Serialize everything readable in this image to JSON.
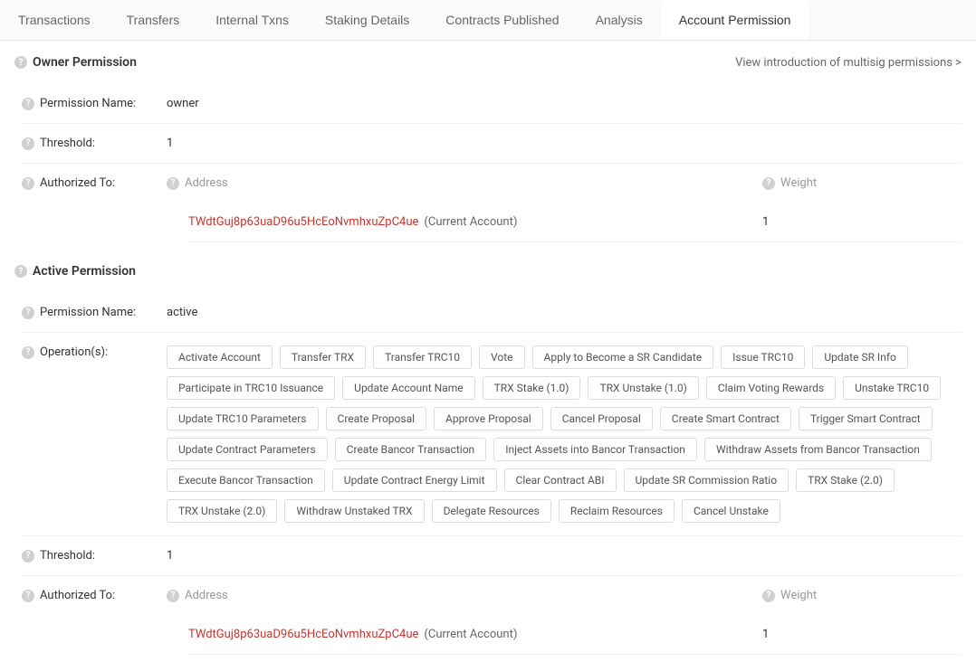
{
  "tabs": [
    {
      "label": "Transactions"
    },
    {
      "label": "Transfers"
    },
    {
      "label": "Internal Txns"
    },
    {
      "label": "Staking Details"
    },
    {
      "label": "Contracts Published"
    },
    {
      "label": "Analysis"
    },
    {
      "label": "Account Permission"
    }
  ],
  "intro_link": "View introduction of multisig permissions >",
  "owner": {
    "title": "Owner Permission",
    "name_label": "Permission Name:",
    "name_value": "owner",
    "threshold_label": "Threshold:",
    "threshold_value": "1",
    "auth_label": "Authorized To:",
    "address_header": "Address",
    "weight_header": "Weight",
    "rows": [
      {
        "address": "TWdtGuj8p63uaD96u5HcEoNvmhxuZpC4ue",
        "note": "(Current Account)",
        "weight": "1"
      }
    ]
  },
  "active": {
    "title": "Active Permission",
    "name_label": "Permission Name:",
    "name_value": "active",
    "ops_label": "Operation(s):",
    "operations": [
      "Activate Account",
      "Transfer TRX",
      "Transfer TRC10",
      "Vote",
      "Apply to Become a SR Candidate",
      "Issue TRC10",
      "Update SR Info",
      "Participate in TRC10 Issuance",
      "Update Account Name",
      "TRX Stake (1.0)",
      "TRX Unstake (1.0)",
      "Claim Voting Rewards",
      "Unstake TRC10",
      "Update TRC10 Parameters",
      "Create Proposal",
      "Approve Proposal",
      "Cancel Proposal",
      "Create Smart Contract",
      "Trigger Smart Contract",
      "Update Contract Parameters",
      "Create Bancor Transaction",
      "Inject Assets into Bancor Transaction",
      "Withdraw Assets from Bancor Transaction",
      "Execute Bancor Transaction",
      "Update Contract Energy Limit",
      "Clear Contract ABI",
      "Update SR Commission Ratio",
      "TRX Stake (2.0)",
      "TRX Unstake (2.0)",
      "Withdraw Unstaked TRX",
      "Delegate Resources",
      "Reclaim Resources",
      "Cancel Unstake"
    ],
    "threshold_label": "Threshold:",
    "threshold_value": "1",
    "auth_label": "Authorized To:",
    "address_header": "Address",
    "weight_header": "Weight",
    "rows": [
      {
        "address": "TWdtGuj8p63uaD96u5HcEoNvmhxuZpC4ue",
        "note": "(Current Account)",
        "weight": "1"
      }
    ]
  },
  "help_glyph": "?"
}
